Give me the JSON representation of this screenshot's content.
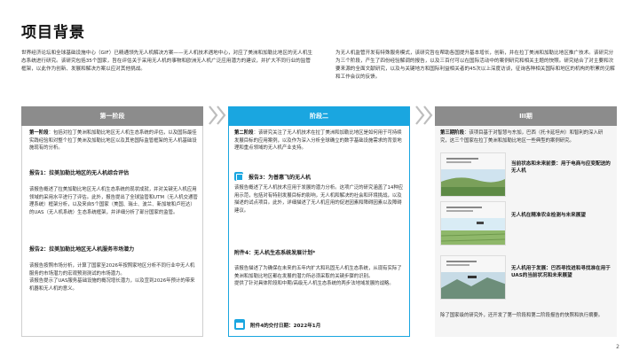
{
  "page": {
    "title": "项目背景",
    "number": "2"
  },
  "intro": {
    "left": "世界经济论坛和全球基础设施中心（GIF）已精通领先无人机解决方案——无人机技术遇地中心，对应了美洲和加勒比地区的无人机生态系统进行研究。该研究包括35个国家，旨在评估关于采用无人机的事物和欧洲无人机广泛应用潜力的建议，并扩大不同行业的监管框架，以此作为创新、发展和解决方案以应对其他挑战。",
    "right": "为无人机监管开发有特殊服务模式，该研究旨在帮助各国提升基本增长，创新，并在拉丁美洲和加勒比地区推广技术。该研究分为三个阶段，产生了四份经验解调的报告，以及三百付可以在国际活动中的案例研究和相关主题的快照。研究结合了对主要和次要来源的全面文献研究，以及与关键地方和国际利益相关者的45次以上深度访谈，征询各种相关国际和地区的机构的积累的见解和工作会议的反馈。"
  },
  "phases": [
    {
      "label": "第一阶段",
      "intro_bold": "第一阶段",
      "intro": "：包括对拉丁美洲和加勒比地区无人机生态系统的评估，以及国际最佳实践经验和对整个拉丁美洲及加勒比地区以及其他国际监管框架的无人机基础设施现有的分析。",
      "deliverables": [
        {
          "title": "报告1：拉美加勒比地区的无人机综合评估",
          "body": "该报告概述了拉美加勒比地区无人机生态系统的现状成就，并对关键无人机应用领域的采用水平进行了评估。此外，报告提出了全球监管和UTM（无人机交通管理系统）框架分析，以及来自5个国家（美国、瑞士、波兰、新加坡和卢旺达）的UAS（无人机系统）生态系统框架，并详细分析了部分国家的监管。"
        },
        {
          "title": "报告2：拉美加勒比地区无人机服务市场潜力",
          "body": "该报告按照市场分析，计算了国家至2026年按照家地区分析不同行业中无人机服务的市场潜力的宏观预测测试的市场潜力。\n该报告提示了UAS服务基础设施的概况增长潜力，以及宣到2026年预计的带来机器和无人机的意义。"
        }
      ]
    },
    {
      "label": "阶段二",
      "intro_bold": "第二阶段",
      "intro": "：该研究关注了无人机技术在拉丁美洲和加勒比地区是如何用于可持续发展目标的应用案例，以及作为深入分析全球确立的数字基础设施需求的背景地理和重点领域的无人机产业支持。",
      "deliverables": [
        {
          "title": "报告3：为普惠飞的无人机",
          "body": "该报告概述了无人机技术应用于发展的潜力分析。这项广泛的研究涵盖了14种应用示范，包括对有特别发展目标的影响，无人机和解决的社会和环境挑战，以及描述的试点项目。此外，详细描述了无人机应用的促进因素和障碍因素以及障碍建议。"
        },
        {
          "title": "附件4：无人机生态系统发展计划*",
          "body": "该报告描述了为确保在未来的五年内扩大和巩固无人机生态系统，从现有实际了美洲和加勒比地区都在发展的潜力所必须采取的关键步骤的识别。\n提供了针对具体阶段和中期/高级无人机生态系统的两步法地域发展的战略。"
        }
      ],
      "footnote": "附件4的交付日期：2022年1月"
    },
    {
      "label": "III期",
      "intro_bold": "第三期阶段",
      "intro": "：该项目基于对智慧与东加，巴西（托卡延坦州）和智利的深入研究，这三个国家在拉丁美洲和加勒比地区一些典型的案例研究。",
      "cases": [
        {
          "title": "当前状态和未来前景：用于电商与应变配送的无人机"
        },
        {
          "title": "无人机在精准农业检测与未来展望"
        },
        {
          "title": "无人机用于发展：巴西寻找进和寻找准在用于UAS的当前状况和未来展望"
        }
      ],
      "footnote": "除了国家级的研究外，还开发了第一阶段和第二阶段报告的快照和执行摘要。"
    }
  ],
  "colors": {
    "active": "#1aa6e0",
    "inactive": "#8c8c8c"
  }
}
